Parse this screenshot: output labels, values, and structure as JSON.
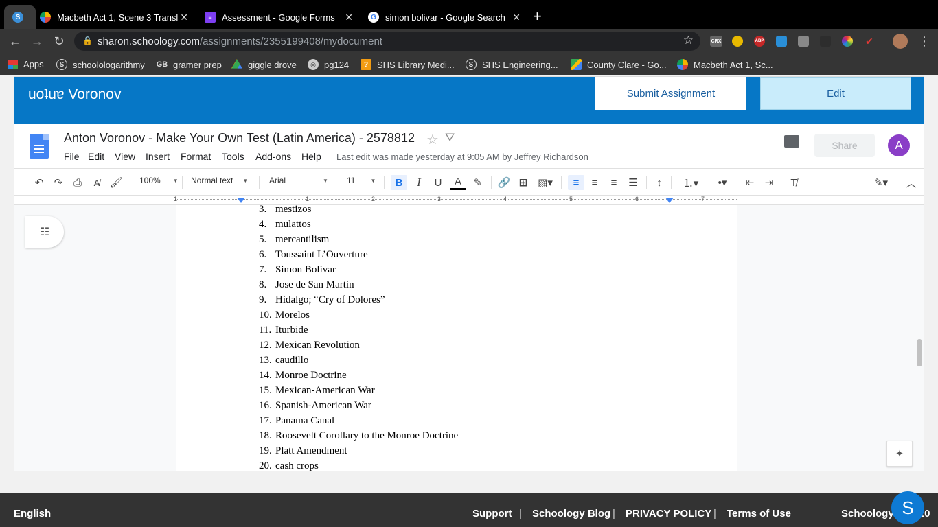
{
  "browser": {
    "tabs": [
      {
        "title": "",
        "favicon": "schoology-icon"
      },
      {
        "title": "Macbeth Act 1, Scene 3 Transla",
        "favicon": "chart-icon"
      },
      {
        "title": "Assessment - Google Forms",
        "favicon": "forms-icon"
      },
      {
        "title": "simon bolivar - Google Search",
        "favicon": "google-icon"
      }
    ],
    "new_tab": "+",
    "url_host": "sharon.schoology.com",
    "url_path": "/assignments/2355199408/mydocument",
    "extensions": [
      "CRX",
      "ABP"
    ],
    "bookmarks": [
      {
        "label": "Apps"
      },
      {
        "label": "schoolologarithmy"
      },
      {
        "label": "gramer prep"
      },
      {
        "label": "giggle drove"
      },
      {
        "label": "pg124"
      },
      {
        "label": "SHS Library Medi..."
      },
      {
        "label": "SHS Engineering..."
      },
      {
        "label": "County Clare - Go..."
      },
      {
        "label": "Macbeth Act 1, Sc..."
      }
    ]
  },
  "schoology": {
    "student_name": "uoʇuɐ Voronov",
    "submit_label": "Submit Assignment",
    "edit_label": "Edit"
  },
  "docs": {
    "title": "Anton Voronov - Make Your Own Test (Latin America) - 2578812",
    "menus": [
      "File",
      "Edit",
      "View",
      "Insert",
      "Format",
      "Tools",
      "Add-ons",
      "Help"
    ],
    "last_edit": "Last edit was made yesterday at 9:05 AM by Jeffrey Richardson",
    "share_label": "Share",
    "avatar_letter": "A",
    "toolbar": {
      "zoom": "100%",
      "style": "Normal text",
      "font": "Arial",
      "size": "11"
    },
    "ruler_numbers": [
      "1",
      "1",
      "2",
      "3",
      "4",
      "5",
      "6",
      "7"
    ]
  },
  "document": {
    "items": [
      {
        "num": "3.",
        "text": "mestizos"
      },
      {
        "num": "4.",
        "text": "mulattos"
      },
      {
        "num": "5.",
        "text": "mercantilism"
      },
      {
        "num": "6.",
        "text": "Toussaint L’Ouverture"
      },
      {
        "num": "7.",
        "text": "Simon Bolivar"
      },
      {
        "num": "8.",
        "text": "Jose de San Martin"
      },
      {
        "num": "9.",
        "text": "Hidalgo; “Cry of Dolores”"
      },
      {
        "num": "10.",
        "text": "Morelos"
      },
      {
        "num": "11.",
        "text": "Iturbide"
      },
      {
        "num": "12.",
        "text": "Mexican Revolution"
      },
      {
        "num": "13.",
        "text": "caudillo"
      },
      {
        "num": "14.",
        "text": "Monroe Doctrine"
      },
      {
        "num": "15.",
        "text": "Mexican-American War"
      },
      {
        "num": "16.",
        "text": "Spanish-American War"
      },
      {
        "num": "17.",
        "text": "Panama Canal"
      },
      {
        "num": "18.",
        "text": "Roosevelt Corollary to the Monroe Doctrine"
      },
      {
        "num": "19.",
        "text": "Platt Amendment"
      },
      {
        "num": "20.",
        "text": "cash crops"
      }
    ]
  },
  "footer": {
    "language": "English",
    "links": [
      "Support",
      "Schoology Blog",
      "PRIVACY POLICY",
      "Terms of Use"
    ],
    "separator": "|",
    "copyright": "Schoology © 2020",
    "bubble": "S"
  }
}
